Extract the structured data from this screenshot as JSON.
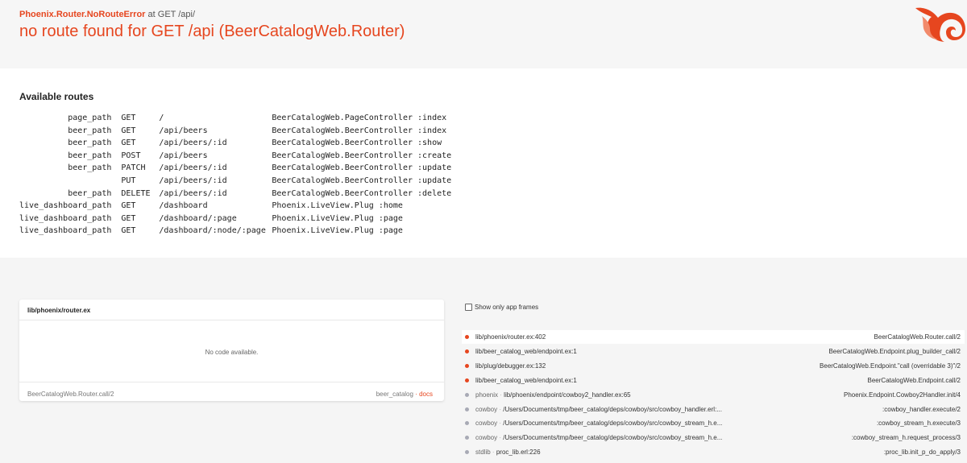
{
  "error": {
    "exception": "Phoenix.Router.NoRouteError",
    "location": "at GET /api/",
    "message": "no route found for GET /api (BeerCatalogWeb.Router)"
  },
  "routes": {
    "heading": "Available routes",
    "rows": [
      {
        "helper": "page_path",
        "verb": "GET",
        "path": "/",
        "plug": "BeerCatalogWeb.PageController :index"
      },
      {
        "helper": "beer_path",
        "verb": "GET",
        "path": "/api/beers",
        "plug": "BeerCatalogWeb.BeerController :index"
      },
      {
        "helper": "beer_path",
        "verb": "GET",
        "path": "/api/beers/:id",
        "plug": "BeerCatalogWeb.BeerController :show"
      },
      {
        "helper": "beer_path",
        "verb": "POST",
        "path": "/api/beers",
        "plug": "BeerCatalogWeb.BeerController :create"
      },
      {
        "helper": "beer_path",
        "verb": "PATCH",
        "path": "/api/beers/:id",
        "plug": "BeerCatalogWeb.BeerController :update"
      },
      {
        "helper": "",
        "verb": "PUT",
        "path": "/api/beers/:id",
        "plug": "BeerCatalogWeb.BeerController :update"
      },
      {
        "helper": "beer_path",
        "verb": "DELETE",
        "path": "/api/beers/:id",
        "plug": "BeerCatalogWeb.BeerController :delete"
      },
      {
        "helper": "live_dashboard_path",
        "verb": "GET",
        "path": "/dashboard",
        "plug": "Phoenix.LiveView.Plug :home"
      },
      {
        "helper": "live_dashboard_path",
        "verb": "GET",
        "path": "/dashboard/:page",
        "plug": "Phoenix.LiveView.Plug :page"
      },
      {
        "helper": "live_dashboard_path",
        "verb": "GET",
        "path": "/dashboard/:node/:page",
        "plug": "Phoenix.LiveView.Plug :page"
      }
    ]
  },
  "code_panel": {
    "file": "lib/phoenix/router.ex",
    "empty_text": "No code available.",
    "function": "BeerCatalogWeb.Router.call/2",
    "app": "beer_catalog",
    "separator": "·",
    "docs_label": "docs"
  },
  "frames_panel": {
    "toggle_label": "Show only app frames",
    "frames": [
      {
        "app": "",
        "file": "lib/phoenix/router.ex:402",
        "fn": "BeerCatalogWeb.Router.call/2",
        "kind": "app"
      },
      {
        "app": "",
        "file": "lib/beer_catalog_web/endpoint.ex:1",
        "fn": "BeerCatalogWeb.Endpoint.plug_builder_call/2",
        "kind": "app"
      },
      {
        "app": "",
        "file": "lib/plug/debugger.ex:132",
        "fn": "BeerCatalogWeb.Endpoint.\"call (overridable 3)\"/2",
        "kind": "app"
      },
      {
        "app": "",
        "file": "lib/beer_catalog_web/endpoint.ex:1",
        "fn": "BeerCatalogWeb.Endpoint.call/2",
        "kind": "app"
      },
      {
        "app": "phoenix",
        "file": "lib/phoenix/endpoint/cowboy2_handler.ex:65",
        "fn": "Phoenix.Endpoint.Cowboy2Handler.init/4",
        "kind": "dep"
      },
      {
        "app": "cowboy",
        "file": "/Users/Documents/tmp/beer_catalog/deps/cowboy/src/cowboy_handler.erl:...",
        "fn": ":cowboy_handler.execute/2",
        "kind": "dep"
      },
      {
        "app": "cowboy",
        "file": "/Users/Documents/tmp/beer_catalog/deps/cowboy/src/cowboy_stream_h.e...",
        "fn": ":cowboy_stream_h.execute/3",
        "kind": "dep"
      },
      {
        "app": "cowboy",
        "file": "/Users/Documents/tmp/beer_catalog/deps/cowboy/src/cowboy_stream_h.e...",
        "fn": ":cowboy_stream_h.request_process/3",
        "kind": "dep"
      },
      {
        "app": "stdlib",
        "file": "proc_lib.erl:226",
        "fn": ":proc_lib.init_p_do_apply/3",
        "kind": "dep"
      }
    ]
  },
  "colors": {
    "accent": "#e6461f",
    "dep_dot": "#a8aab5",
    "background": "#f5f5f5"
  }
}
